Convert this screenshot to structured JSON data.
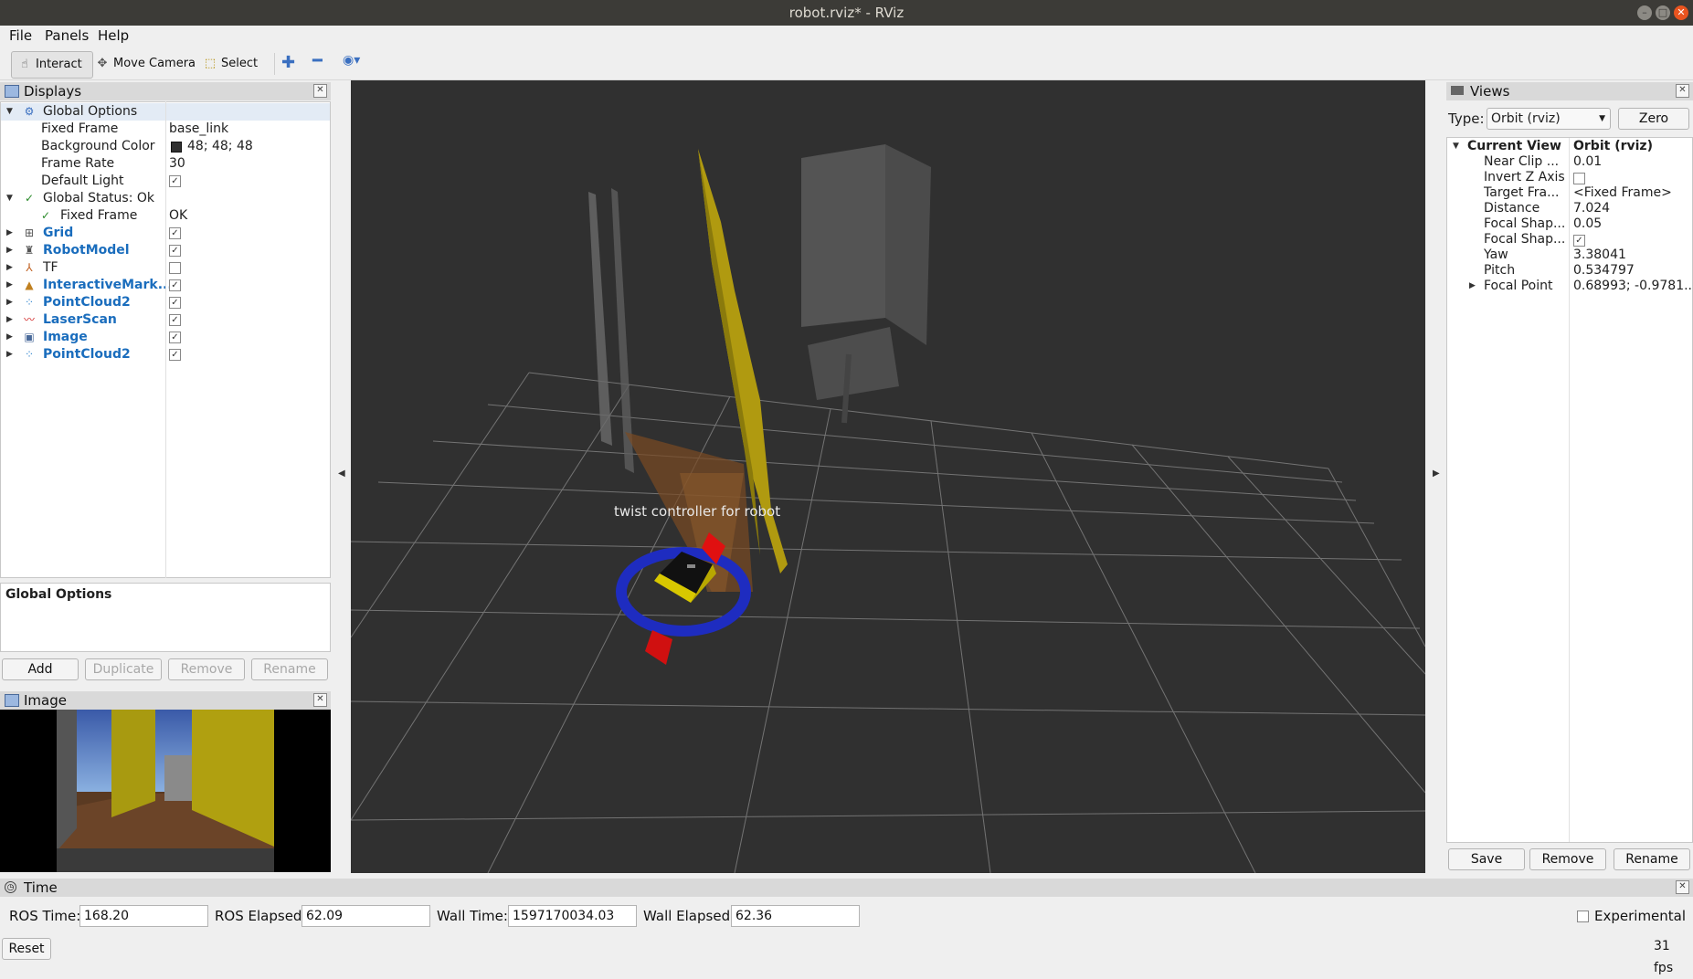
{
  "window": {
    "title": "robot.rviz* - RViz"
  },
  "menu": {
    "file": "File",
    "panels": "Panels",
    "help": "Help"
  },
  "toolbar": {
    "interact": "Interact",
    "move_camera": "Move Camera",
    "select": "Select"
  },
  "displays": {
    "title": "Displays",
    "rows": [
      {
        "name": "Global Options",
        "value": ""
      },
      {
        "name": "Fixed Frame",
        "value": "base_link"
      },
      {
        "name": "Background Color",
        "value": "48; 48; 48"
      },
      {
        "name": "Frame Rate",
        "value": "30"
      },
      {
        "name": "Default Light",
        "value": ""
      },
      {
        "name": "Global Status: Ok",
        "value": ""
      },
      {
        "name": "Fixed Frame",
        "value": "OK"
      },
      {
        "name": "Grid",
        "value": ""
      },
      {
        "name": "RobotModel",
        "value": ""
      },
      {
        "name": "TF",
        "value": ""
      },
      {
        "name": "InteractiveMark...",
        "value": ""
      },
      {
        "name": "PointCloud2",
        "value": ""
      },
      {
        "name": "LaserScan",
        "value": ""
      },
      {
        "name": "Image",
        "value": ""
      },
      {
        "name": "PointCloud2",
        "value": ""
      }
    ],
    "description_title": "Global Options",
    "buttons": {
      "add": "Add",
      "duplicate": "Duplicate",
      "remove": "Remove",
      "rename": "Rename"
    },
    "bg_swatch_color": "#303030"
  },
  "image_panel": {
    "title": "Image"
  },
  "viewport": {
    "overlay_text": "twist  controller  for  robot",
    "background": "#303030"
  },
  "views": {
    "title": "Views",
    "type_label": "Type:",
    "type_value": "Orbit (rviz)",
    "zero": "Zero",
    "rows": [
      {
        "name": "Current View",
        "value": "Orbit (rviz)"
      },
      {
        "name": "Near Clip ...",
        "value": "0.01"
      },
      {
        "name": "Invert Z Axis",
        "value": ""
      },
      {
        "name": "Target Fra...",
        "value": "<Fixed Frame>"
      },
      {
        "name": "Distance",
        "value": "7.024"
      },
      {
        "name": "Focal Shap...",
        "value": "0.05"
      },
      {
        "name": "Focal Shap...",
        "value": ""
      },
      {
        "name": "Yaw",
        "value": "3.38041"
      },
      {
        "name": "Pitch",
        "value": "0.534797"
      },
      {
        "name": "Focal Point",
        "value": "0.68993; -0.9781..."
      }
    ],
    "buttons": {
      "save": "Save",
      "remove": "Remove",
      "rename": "Rename"
    }
  },
  "time": {
    "title": "Time",
    "ros_time_label": "ROS Time:",
    "ros_time": "168.20",
    "ros_elapsed_label": "ROS Elapsed:",
    "ros_elapsed": "62.09",
    "wall_time_label": "Wall Time:",
    "wall_time": "1597170034.03",
    "wall_elapsed_label": "Wall Elapsed:",
    "wall_elapsed": "62.36",
    "experimental": "Experimental",
    "reset": "Reset",
    "fps": "31 fps"
  }
}
